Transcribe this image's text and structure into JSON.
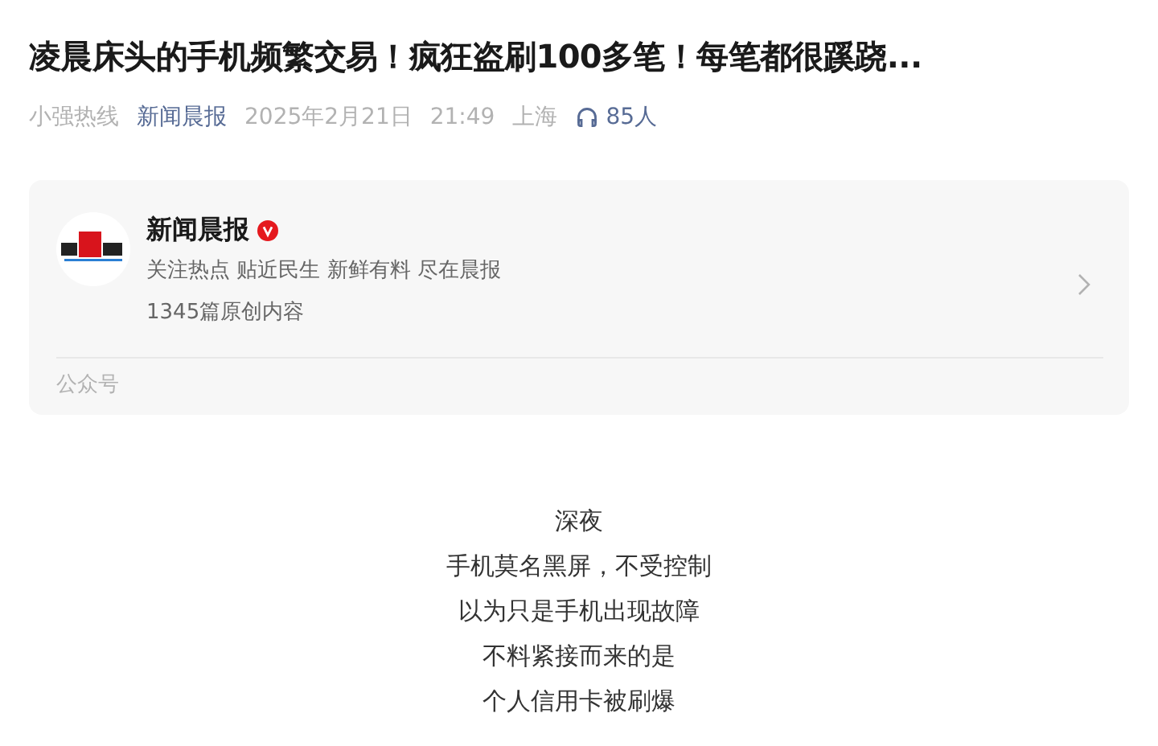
{
  "title": "凌晨床头的手机频繁交易！疯狂盗刷100多笔！每笔都很蹊跷...",
  "meta": {
    "author": "小强热线",
    "account": "新闻晨报",
    "date": "2025年2月21日",
    "time": "21:49",
    "location": "上海",
    "listeners": "85人"
  },
  "card": {
    "name": "新闻晨报",
    "verified": true,
    "slogan": "关注热点 贴近民生 新鲜有料 尽在晨报",
    "count": "1345篇原创内容",
    "type": "公众号"
  },
  "body": [
    "深夜",
    "手机莫名黑屏，不受控制",
    "以为只是手机出现故障",
    "不料紧接而来的是",
    "个人信用卡被刷爆"
  ]
}
